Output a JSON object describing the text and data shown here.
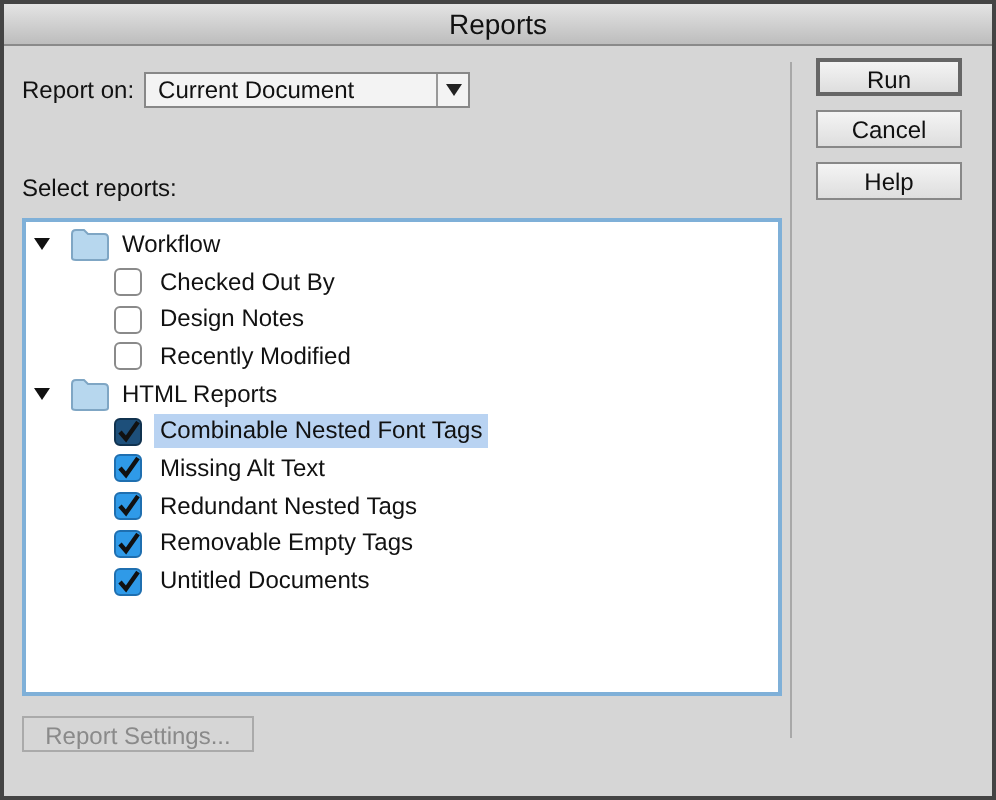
{
  "window": {
    "title": "Reports"
  },
  "report_on": {
    "label": "Report on:",
    "value": "Current Document"
  },
  "select_label": "Select reports:",
  "tree": [
    {
      "label": "Workflow",
      "expanded": true,
      "children": [
        {
          "label": "Checked Out By",
          "checked": false,
          "selected": false
        },
        {
          "label": "Design Notes",
          "checked": false,
          "selected": false
        },
        {
          "label": "Recently Modified",
          "checked": false,
          "selected": false
        }
      ]
    },
    {
      "label": "HTML Reports",
      "expanded": true,
      "children": [
        {
          "label": "Combinable Nested Font Tags",
          "checked": true,
          "selected": true
        },
        {
          "label": "Missing Alt Text",
          "checked": true,
          "selected": false
        },
        {
          "label": "Redundant Nested Tags",
          "checked": true,
          "selected": false
        },
        {
          "label": "Removable Empty Tags",
          "checked": true,
          "selected": false
        },
        {
          "label": "Untitled Documents",
          "checked": true,
          "selected": false
        }
      ]
    }
  ],
  "settings_button": {
    "label": "Report Settings...",
    "disabled": true
  },
  "buttons": [
    {
      "label": "Run",
      "default": true
    },
    {
      "label": "Cancel",
      "default": false
    },
    {
      "label": "Help",
      "default": false
    }
  ]
}
